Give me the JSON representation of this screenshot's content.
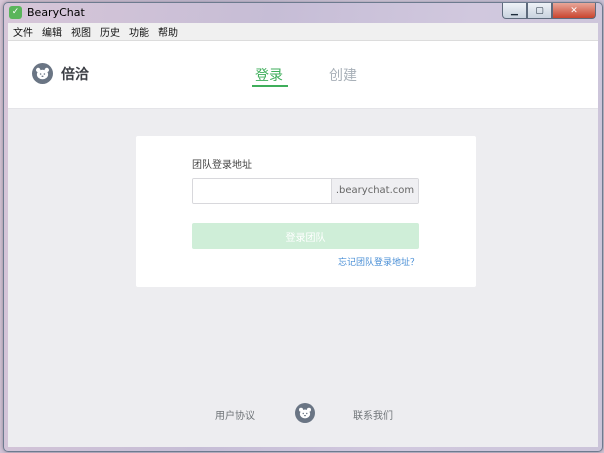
{
  "window": {
    "title": "BearyChat",
    "controls": {
      "minimize": "▁",
      "maximize": "▢",
      "close": "✕"
    }
  },
  "menu": {
    "items": [
      "文件",
      "编辑",
      "视图",
      "历史",
      "功能",
      "帮助"
    ]
  },
  "header": {
    "brand": "倍洽",
    "tabs": [
      {
        "label": "登录",
        "active": true
      },
      {
        "label": "创建",
        "active": false
      }
    ]
  },
  "login": {
    "field_label": "团队登录地址",
    "team_input_value": "",
    "domain_suffix": ".bearychat.com",
    "button_label": "登录团队",
    "forgot_link": "忘记团队登录地址？"
  },
  "footer": {
    "agreement": "用户协议",
    "contact": "联系我们"
  },
  "colors": {
    "accent": "#3fae5b",
    "button_disabled": "#cfeed8",
    "link": "#4a8fd6",
    "background": "#ededf0"
  },
  "icons": {
    "app": "bearychat-app-icon",
    "logo": "bear-logo-icon",
    "footer": "bear-logo-icon"
  }
}
